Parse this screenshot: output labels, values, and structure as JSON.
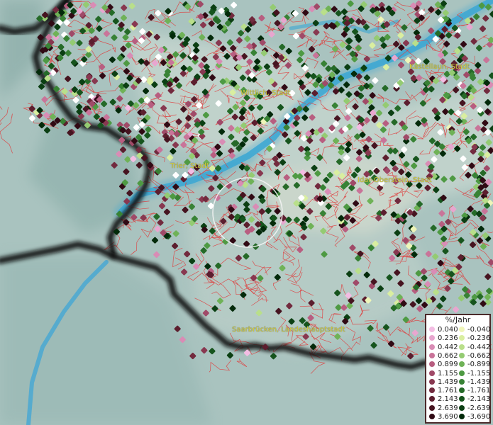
{
  "cities": [
    {
      "id": "wittlich",
      "name": "Wittlich, Stadt"
    },
    {
      "id": "kastellaun",
      "name": "Kastellaun, Stadt"
    },
    {
      "id": "trier",
      "name": "Trier, Stadt"
    },
    {
      "id": "idar-oberstein",
      "name": "Idar-Oberstein, Stadt"
    },
    {
      "id": "saarbruecken",
      "name": "Saarbrücken, Landeshauptstadt"
    }
  ],
  "legend": {
    "title": "%/Jahr",
    "positive": [
      {
        "value": "0.040",
        "color": "#f3bde3"
      },
      {
        "value": "0.236",
        "color": "#e8a6cf"
      },
      {
        "value": "0.442",
        "color": "#d98cb5"
      },
      {
        "value": "0.662",
        "color": "#c97499"
      },
      {
        "value": "0.899",
        "color": "#b85e80"
      },
      {
        "value": "1.155",
        "color": "#a04a68"
      },
      {
        "value": "1.439",
        "color": "#883850"
      },
      {
        "value": "1.761",
        "color": "#722a3e"
      },
      {
        "value": "2.143",
        "color": "#5c1e2e"
      },
      {
        "value": "2.639",
        "color": "#461420"
      },
      {
        "value": "3.690",
        "color": "#300a14"
      }
    ],
    "negative": [
      {
        "value": "-0.040",
        "color": "#eef5b8"
      },
      {
        "value": "-0.236",
        "color": "#d9eea0"
      },
      {
        "value": "-0.442",
        "color": "#b9df8a"
      },
      {
        "value": "-0.662",
        "color": "#94cb72"
      },
      {
        "value": "-0.899",
        "color": "#6fb257"
      },
      {
        "value": "-1.155",
        "color": "#4e9a43"
      },
      {
        "value": "-1.439",
        "color": "#388235"
      },
      {
        "value": "-1.761",
        "color": "#256a28"
      },
      {
        "value": "-2.143",
        "color": "#16541d"
      },
      {
        "value": "-2.639",
        "color": "#0b3f13"
      },
      {
        "value": "-3.690",
        "color": "#032a0a"
      }
    ]
  },
  "colors": {
    "terrain": "#a9c4c0",
    "river": "#3aa7d4",
    "border": "#111111",
    "district_lines": "#e03a3a",
    "label": "#d8d23a"
  }
}
